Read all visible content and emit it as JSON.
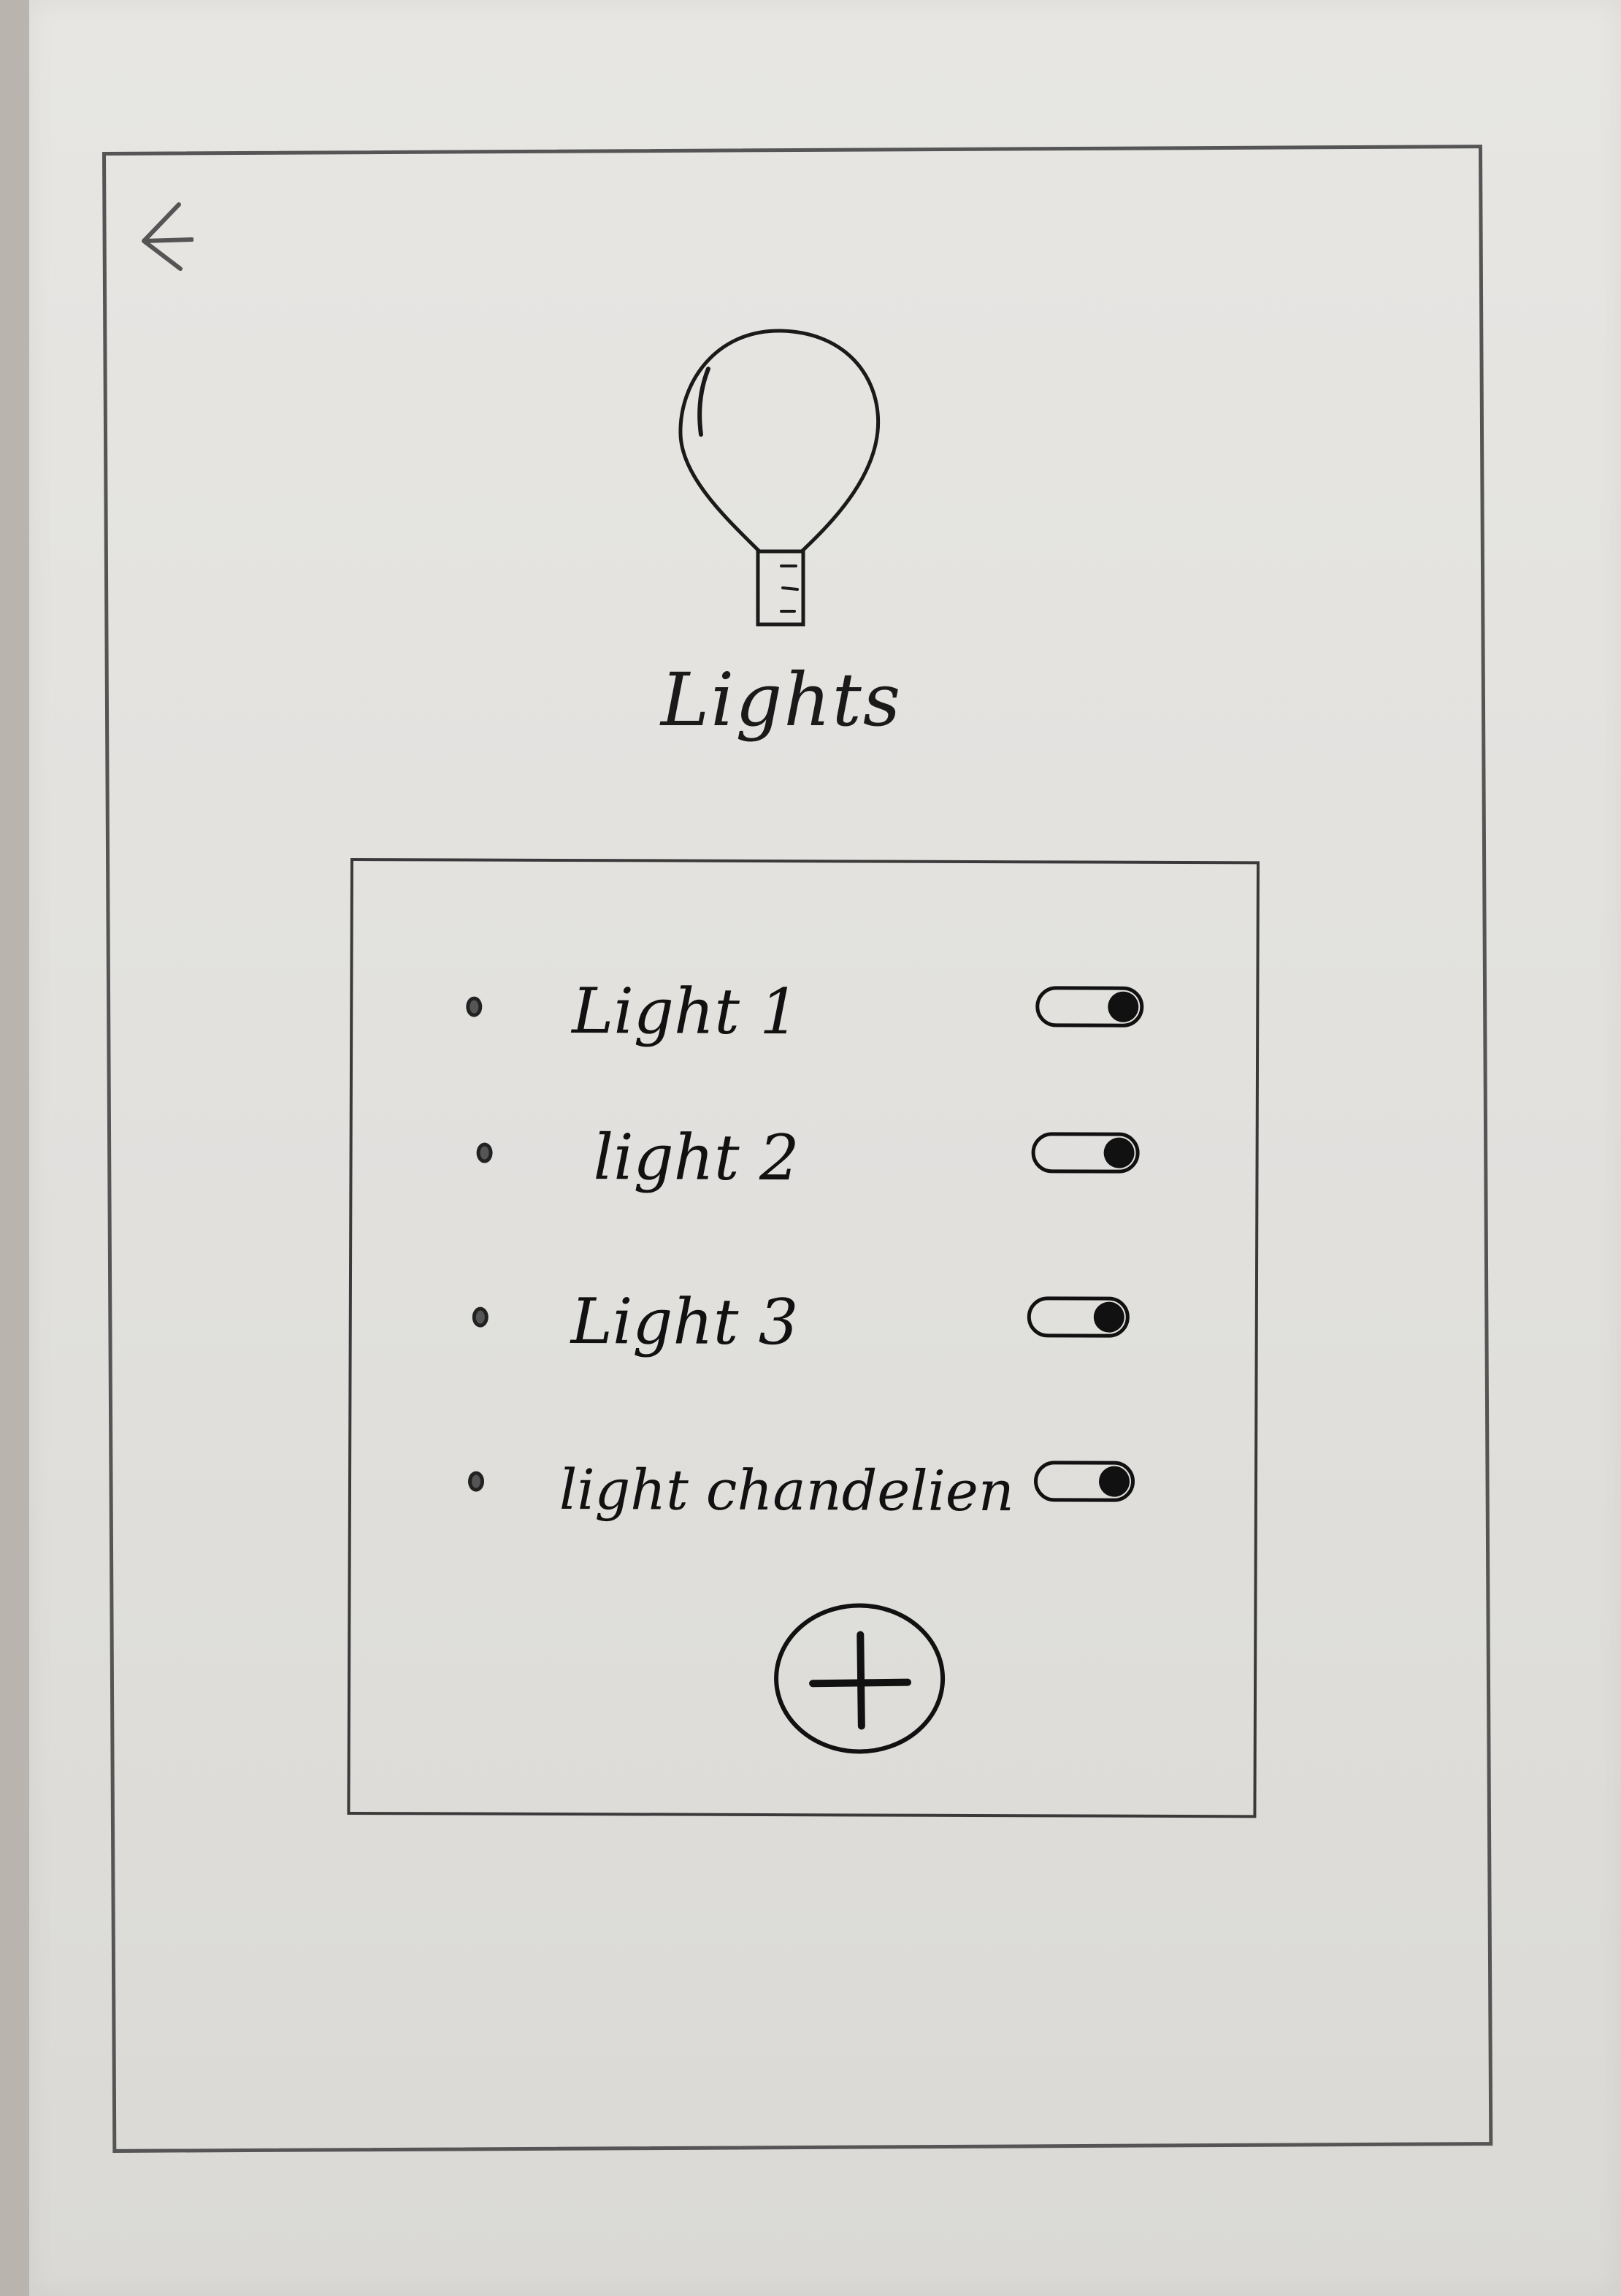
{
  "header": {
    "title": "Lights",
    "back_icon": "back-arrow-icon"
  },
  "hero": {
    "icon": "light-bulb-icon"
  },
  "lights": [
    {
      "label": "Light 1",
      "on": true
    },
    {
      "label": "light 2",
      "on": true
    },
    {
      "label": "Light 3",
      "on": true
    },
    {
      "label": "light chandelien",
      "on": true
    }
  ],
  "actions": {
    "add_icon": "plus-icon"
  },
  "colors": {
    "ink": "#111111",
    "paper": "#e4e3e0"
  }
}
